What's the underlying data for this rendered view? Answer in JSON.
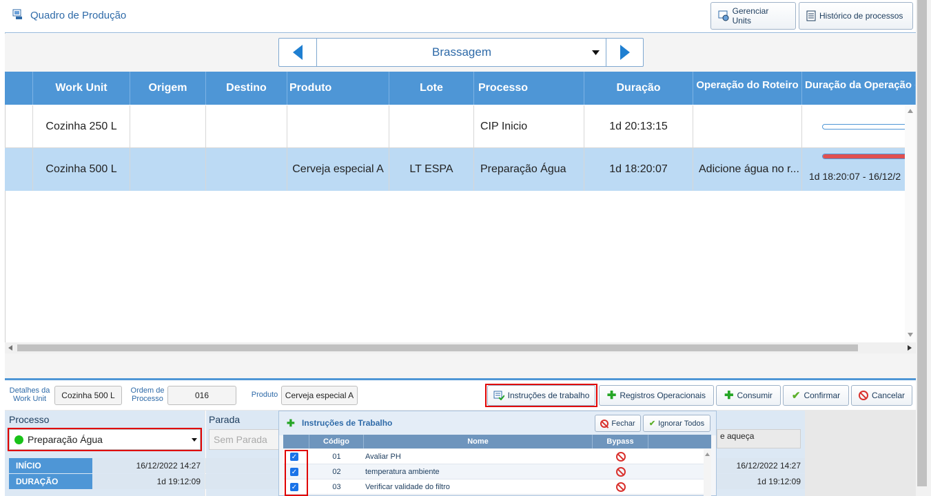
{
  "header": {
    "title": "Quadro de Produção",
    "buttons": {
      "manage_units": "Gerenciar Units",
      "history": "Histórico de processos"
    }
  },
  "nav": {
    "selected": "Brassagem"
  },
  "grid": {
    "columns": [
      "Work Unit",
      "Origem",
      "Destino",
      "Produto",
      "Lote",
      "Processo",
      "Duração",
      "Operação do Roteiro",
      "Duração da Operação d"
    ],
    "rows": [
      {
        "work_unit": "Cozinha 250 L",
        "origem": "",
        "destino": "",
        "produto": "",
        "lote": "",
        "processo": "CIP Inicio",
        "duracao": "1d 20:13:15",
        "operacao": "",
        "dur_op": "",
        "progress": 0.0
      },
      {
        "work_unit": "Cozinha 500 L",
        "origem": "",
        "destino": "",
        "produto": "Cerveja especial A",
        "lote": "LT ESPA",
        "processo": "Preparação Água",
        "duracao": "1d 18:20:07",
        "operacao": "Adicione água no r...",
        "dur_op": "1d 18:20:07 - 16/12/2",
        "progress": 1.0
      }
    ]
  },
  "details": {
    "work_unit_label": "Detalhes da Work Unit",
    "work_unit_value": "Cozinha 500 L",
    "ordem_label": "Ordem de Processo",
    "ordem_value": "016",
    "produto_label": "Produto",
    "produto_value": "Cerveja especial A"
  },
  "actions": {
    "instrucoes": "Instruções de trabalho",
    "registros": "Registros Operacionais",
    "consumir": "Consumir",
    "confirmar": "Confirmar",
    "cancelar": "Cancelar"
  },
  "processo": {
    "label": "Processo",
    "value": "Preparação Água",
    "status_color": "#19c219",
    "parada_label": "Parada",
    "parada_placeholder": "Sem Parada",
    "inicio_label": "INÍCIO",
    "inicio_value": "16/12/2022 14:27",
    "duracao_label": "DURAÇÃO",
    "duracao_value": "1d 19:12:09"
  },
  "right_panel": {
    "note": "e aqueça",
    "inicio_value": "16/12/2022 14:27",
    "duracao_value": "1d 19:12:09"
  },
  "popup": {
    "title": "Instruções de Trabalho",
    "close": "Fechar",
    "ignore_all": "Ignorar Todos",
    "columns": {
      "codigo": "Código",
      "nome": "Nome",
      "bypass": "Bypass"
    },
    "items": [
      {
        "codigo": "01",
        "nome": "Avaliar PH",
        "checked": true
      },
      {
        "codigo": "02",
        "nome": "temperatura ambiente",
        "checked": true
      },
      {
        "codigo": "03",
        "nome": "Verificar validade do filtro",
        "checked": true
      }
    ]
  },
  "colors": {
    "accent": "#4e96d6",
    "selected_row": "#bcdaf4",
    "highlight": "#e00000"
  }
}
